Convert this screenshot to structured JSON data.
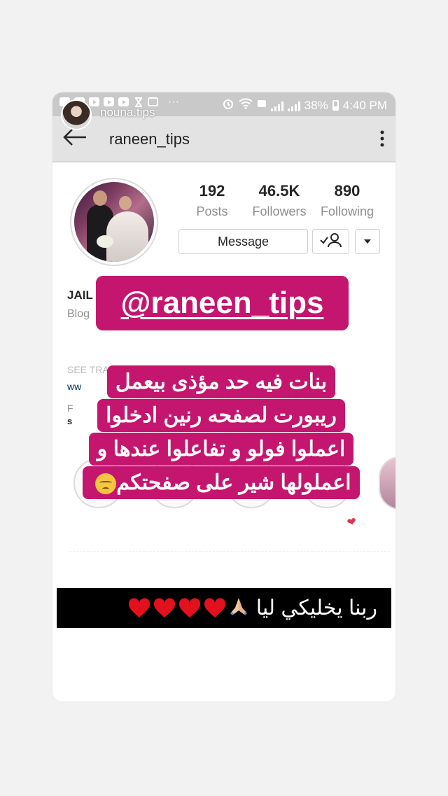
{
  "story": {
    "username": "nouna.tips"
  },
  "status_bar": {
    "battery_percent": "38%",
    "time": "4:40 PM",
    "dots": "···"
  },
  "header": {
    "username": "raneen_tips"
  },
  "profile": {
    "stats": [
      {
        "value": "192",
        "label": "Posts"
      },
      {
        "value": "46.5K",
        "label": "Followers"
      },
      {
        "value": "890",
        "label": "Following"
      }
    ],
    "message_label": "Message",
    "bio_name": "JAIL",
    "bio_category": "Blog",
    "see_translation": "SEE TRAN",
    "bio_link": "ww",
    "bio_f": "F",
    "bio_s": "s"
  },
  "overlay": {
    "mention": "@raneen_tips",
    "arabic_lines": [
      "بنات فيه حد مؤذى بيعمل",
      "ريبورت لصفحه رنين ادخلوا",
      "اعملوا فولو و تفاعلوا عندها و",
      "اعملولها شير على صفحتكم"
    ],
    "caption": "ربنا يخليكي ليا",
    "colors": {
      "accent": "#c4166f",
      "caption_bg": "#000000"
    }
  }
}
